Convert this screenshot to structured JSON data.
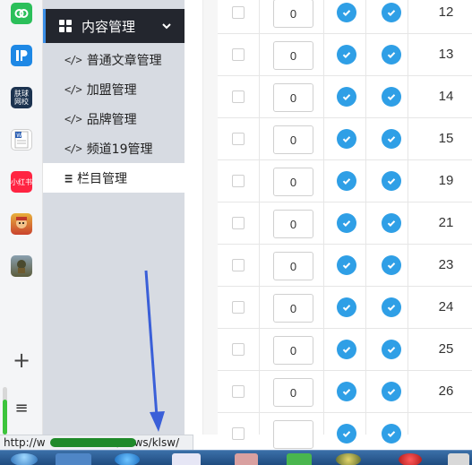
{
  "dock": {
    "icons": [
      {
        "name": "chain-app-icon",
        "color": "#2bbf5a"
      },
      {
        "name": "ip-app-icon",
        "color": "#1e88e5"
      },
      {
        "name": "fuqiu-app-icon",
        "color": "#1c3350",
        "label": "肤球\n网校"
      },
      {
        "name": "word-doc-icon",
        "color": "#ffffff"
      },
      {
        "name": "xiaohongshu-icon",
        "color": "#ff2442",
        "label": "小红书"
      },
      {
        "name": "game-character-icon",
        "color": "#d9523a"
      },
      {
        "name": "pubg-game-icon",
        "color": "#6b6f4a"
      }
    ],
    "add_label": "+",
    "list_label": "≡"
  },
  "sidebar": {
    "menu_title": "内容管理",
    "menu_icon": "grid-icon",
    "menu_toggle": "chevron-down-icon",
    "items": [
      {
        "label": "普通文章管理",
        "icon": "</>"
      },
      {
        "label": "加盟管理",
        "icon": "</>"
      },
      {
        "label": "品牌管理",
        "icon": "</>"
      },
      {
        "label": "频道19管理",
        "icon": "</>"
      },
      {
        "label": "栏目管理",
        "icon": "≡",
        "active": true
      }
    ]
  },
  "table": {
    "rows": [
      {
        "order": "0",
        "enabled": true,
        "visible": true,
        "id": "12"
      },
      {
        "order": "0",
        "enabled": true,
        "visible": true,
        "id": "13"
      },
      {
        "order": "0",
        "enabled": true,
        "visible": true,
        "id": "14"
      },
      {
        "order": "0",
        "enabled": true,
        "visible": true,
        "id": "15"
      },
      {
        "order": "0",
        "enabled": true,
        "visible": true,
        "id": "19"
      },
      {
        "order": "0",
        "enabled": true,
        "visible": true,
        "id": "21"
      },
      {
        "order": "0",
        "enabled": true,
        "visible": true,
        "id": "23"
      },
      {
        "order": "0",
        "enabled": true,
        "visible": true,
        "id": "24"
      },
      {
        "order": "0",
        "enabled": true,
        "visible": true,
        "id": "25"
      },
      {
        "order": "0",
        "enabled": true,
        "visible": true,
        "id": "26"
      },
      {
        "order": "",
        "enabled": true,
        "visible": true,
        "id": ""
      }
    ],
    "accent": "#2f9fe6"
  },
  "statusbar": {
    "url_prefix": "http://w",
    "url_suffix": "/news/klsw/"
  },
  "annotation": {
    "color": "#3a5fd8"
  }
}
